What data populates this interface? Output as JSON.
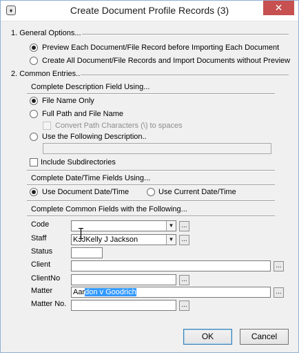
{
  "window": {
    "title": "Create Document Profile Records (3)",
    "close_glyph": "✕"
  },
  "general": {
    "heading": "1. General Options...",
    "opt_preview": "Preview Each Document/File Record before Importing Each Document",
    "opt_create_all": "Create All Document/File Records and Import Documents without Preview"
  },
  "common": {
    "heading": "2. Common Entries...",
    "description": {
      "heading": "Complete Description Field Using...",
      "file_name_only": "File Name Only",
      "full_path": "Full Path and File Name",
      "convert_path": "Convert Path Characters (\\) to spaces",
      "use_following": "Use the Following Description..",
      "following_value": ""
    },
    "include_subdirs": "Include Subdirectories",
    "dates": {
      "heading": "Complete Date/Time Fields Using...",
      "use_document": "Use Document Date/Time",
      "use_current": "Use Current Date/Time"
    },
    "fields": {
      "heading": "Complete Common Fields with the Following...",
      "code": {
        "label": "Code",
        "value": ""
      },
      "staff": {
        "label": "Staff",
        "value": "KJJKelly J Jackson"
      },
      "status": {
        "label": "Status",
        "value": ""
      },
      "client": {
        "label": "Client",
        "value": ""
      },
      "clientno": {
        "label": "ClientNo",
        "value": ""
      },
      "matter": {
        "label": "Matter",
        "value_unselected": "Aar",
        "value_selected": "don v Goodrich"
      },
      "matterno": {
        "label": "Matter No.",
        "value": ""
      }
    }
  },
  "buttons": {
    "ok": "OK",
    "cancel": "Cancel",
    "lookup": "..."
  }
}
